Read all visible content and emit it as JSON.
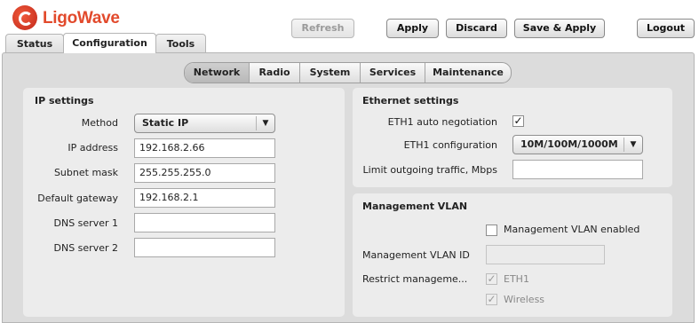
{
  "header": {
    "brand": "LigoWave",
    "buttons": {
      "refresh": "Refresh",
      "apply": "Apply",
      "discard": "Discard",
      "save_apply": "Save & Apply",
      "logout": "Logout"
    },
    "refresh_disabled": true
  },
  "main_tabs": [
    {
      "label": "Status",
      "active": false
    },
    {
      "label": "Configuration",
      "active": true
    },
    {
      "label": "Tools",
      "active": false
    }
  ],
  "sub_tabs": [
    {
      "label": "Network",
      "active": true
    },
    {
      "label": "Radio",
      "active": false
    },
    {
      "label": "System",
      "active": false
    },
    {
      "label": "Services",
      "active": false
    },
    {
      "label": "Maintenance",
      "active": false
    }
  ],
  "ip_settings": {
    "title": "IP settings",
    "method_label": "Method",
    "method_value": "Static IP",
    "ip_label": "IP address",
    "ip_value": "192.168.2.66",
    "mask_label": "Subnet mask",
    "mask_value": "255.255.255.0",
    "gateway_label": "Default gateway",
    "gateway_value": "192.168.2.1",
    "dns1_label": "DNS server 1",
    "dns1_value": "",
    "dns2_label": "DNS server 2",
    "dns2_value": ""
  },
  "ethernet": {
    "title": "Ethernet settings",
    "autoneg_label": "ETH1 auto negotiation",
    "autoneg_checked": true,
    "config_label": "ETH1 configuration",
    "config_value": "10M/100M/1000M",
    "limit_label": "Limit outgoing traffic, Mbps",
    "limit_value": ""
  },
  "vlan": {
    "title": "Management VLAN",
    "enabled_label": "Management VLAN enabled",
    "enabled_checked": false,
    "id_label": "Management VLAN ID",
    "id_value": "",
    "restrict_label": "Restrict manageme...",
    "restrict_eth1_label": "ETH1",
    "restrict_wireless_label": "Wireless",
    "restrict_eth1_checked": true,
    "restrict_wireless_checked": true
  },
  "colors": {
    "brand": "#e24a2c",
    "content_bg": "#dcdcdc",
    "panel_bg": "#ececec"
  }
}
